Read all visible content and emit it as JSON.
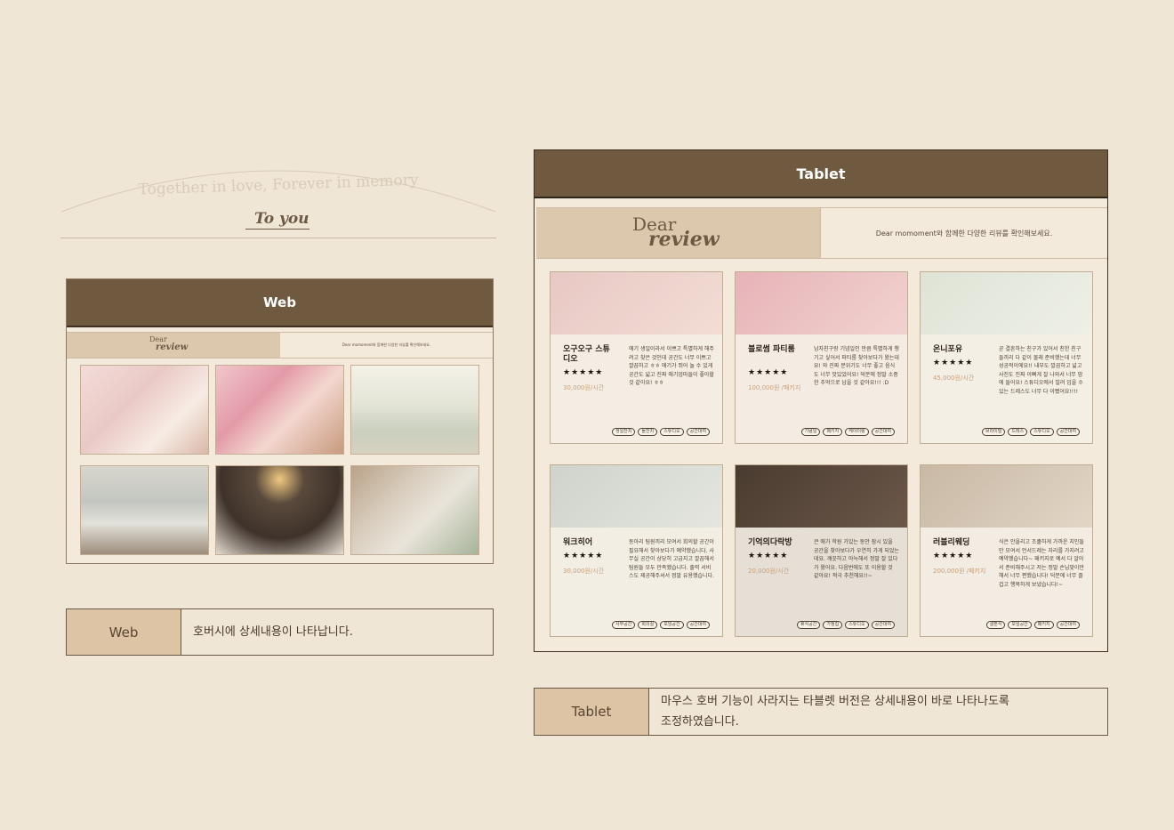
{
  "intro": {
    "motto": "Together in love, Forever in memory",
    "signature": "To you"
  },
  "web": {
    "header_title": "Web",
    "logo_line1": "Dear",
    "logo_line2": "review",
    "banner_text": "Dear momoment와 함께한 다양한 리뷰를 확인해보세요.",
    "photos": [
      {
        "icon": "photo-first-birthday"
      },
      {
        "icon": "photo-flower-table"
      },
      {
        "icon": "photo-white-flowers"
      },
      {
        "icon": "photo-window-view"
      },
      {
        "icon": "photo-child-reading"
      },
      {
        "icon": "photo-wedding-table"
      }
    ]
  },
  "web_caption": {
    "label": "Web",
    "text": "호버시에 상세내용이 나타납니다."
  },
  "tablet": {
    "header_title": "Tablet",
    "logo_line1": "Dear",
    "logo_line2": "review",
    "banner_text": "Dear momoment와 함께한 다양한 리뷰를 확인해보세요.",
    "cards": [
      {
        "name": "오구오구 스튜디오",
        "stars": "★★★★★",
        "price": "30,000원/시간",
        "review": "애기 생일이라서 이쁘고 특별하게 해주려고 찾은 것인데 공간도 너무 이쁘고 깔끔하고 ㅎㅎ 애기가 뛰어 놀 수 있게 공간도 넓고 진짜 애기엄마들이 좋아할 것 같아요! ㅎㅎ",
        "tags": [
          "생일잔치",
          "돌잔치",
          "스튜디오",
          "공간대여"
        ],
        "colors": [
          "#e8c8c4",
          "#f2ddd5"
        ]
      },
      {
        "name": "블로썸 파티룸",
        "stars": "★★★★★",
        "price": "100,000원 /패키지",
        "review": "남자친구랑 기념일인 만큼 특별하게 챙기고 싶어서 파티룸 찾아보다가 왔는데요! 와 진짜 분위기도 너무 좋고 음식도 너무 맛있었어요! 덕분에 정말 소중한 추억으로 남을 것 같아요!!! :D",
        "tags": [
          "기념일",
          "패키지",
          "케이터링",
          "공간대여"
        ],
        "colors": [
          "#e7b3b8",
          "#f1d2cf"
        ]
      },
      {
        "name": "온니포유",
        "stars": "★★★★★",
        "price": "45,000원/시간",
        "review": "곧 결혼하는 친구가 있어서 친한 친구들끼리 다 같이 몰래 준비했는데 너무 성공적이에요!! 내부도 깔끔하고 넓고 사진도 진짜 이뻐게 잘 나와서 너무 맘에 들어요! 스튜디오에서 빌려 입을 수 있는 드레스도 너무 다 이뻤어요!!!!",
        "tags": [
          "브라이덜",
          "드레스",
          "스튜디오",
          "공간대여"
        ],
        "colors": [
          "#dfe3d6",
          "#eef0e6"
        ]
      },
      {
        "name": "워크히어",
        "stars": "★★★★★",
        "price": "30,000원/시간",
        "review": "동아리 팀원끼리 모여서 회의할 공간이 필요해서 찾아보다가 예약했습니다. 사무실 공간이 상당히 고급지고 깔끔해서 팀원들 모두 만족했습니다. 출력 서비스도 제공해주셔서 정말 유용했습니다.",
        "tags": [
          "사무공간",
          "회의실",
          "모임공간",
          "공간대여"
        ],
        "colors": [
          "#cfd3cc",
          "#e4e6df"
        ]
      },
      {
        "name": "기억의다락방",
        "stars": "★★★★★",
        "price": "20,000원/시간",
        "review": "큰 애가 학원 가있는 동안 잠시 있을 공간을 찾아보다가 우연히 가게 되었는데요. 깨끗하고 아늑해서 정말 잘 있다가 왔어요. 다음번에도 또 이용할 것 같아요! 적극 추천해요!!~",
        "tags": [
          "휴식공간",
          "가정집",
          "스튜디오",
          "공간대여"
        ],
        "colors": [
          "#4a3b30",
          "#6b5849"
        ]
      },
      {
        "name": "러블리웨딩",
        "stars": "★★★★★",
        "price": "200,000원 /패키지",
        "review": "식은 안올리고 조촐하게 가까운 지인들만 모여서 언서드레는 자리를 가지려고 예약했습니다~ 패키지로 예서 다 알아서 준비해주시고 저는 정말 손님맞이만 해서 너무 편했습니다! 덕분에 너무 즐겁고 행복하게 보냈습니다!~",
        "tags": [
          "결혼식",
          "모임공간",
          "패키지",
          "공간대여"
        ],
        "colors": [
          "#c8b8a4",
          "#e2d6c6"
        ]
      }
    ]
  },
  "tablet_caption": {
    "label": "Tablet",
    "text": "마우스 호버 기능이 사라지는 타블렛 버전은 상세내용이 바로 나타나도록 조정하였습니다."
  }
}
